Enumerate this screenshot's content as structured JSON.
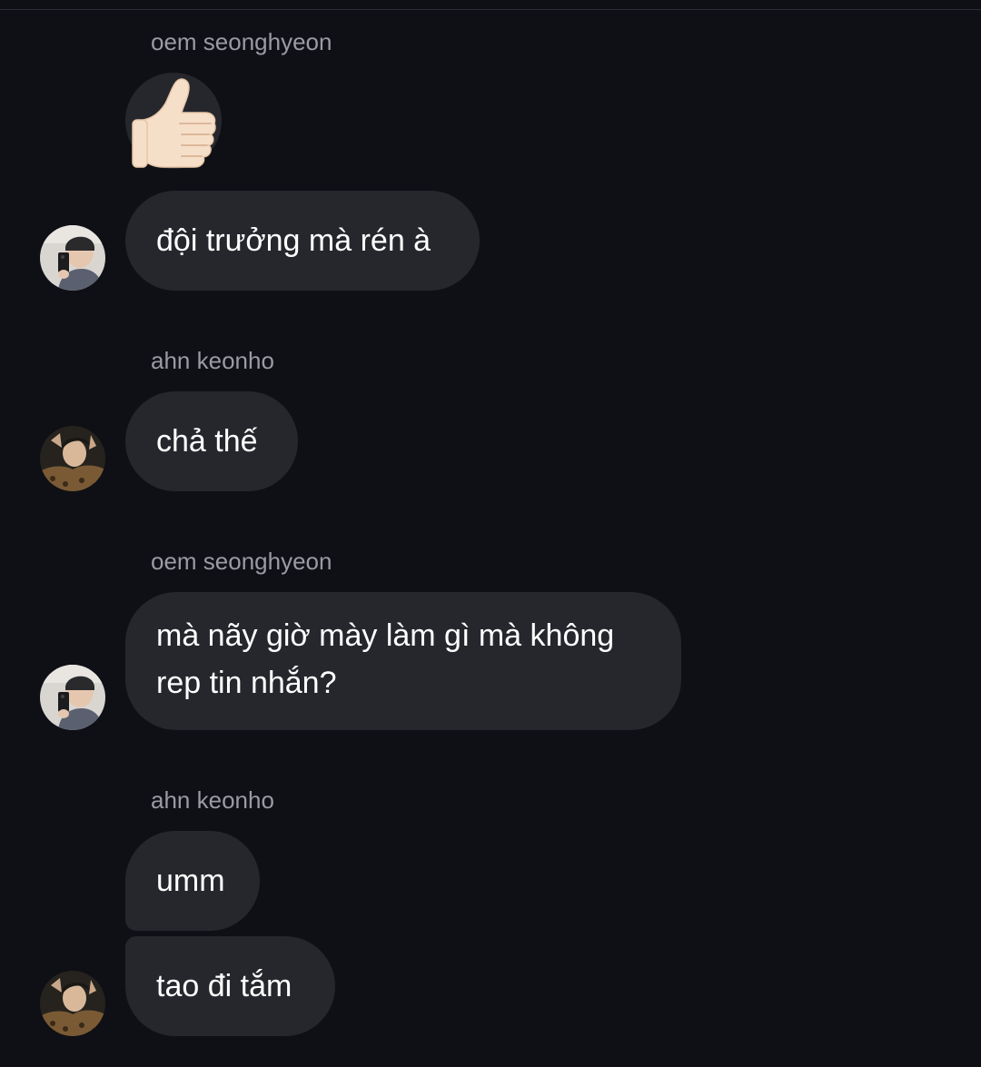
{
  "messages": [
    {
      "sender": "oem seonghyeon",
      "type": "emoji",
      "emoji": "thumbs-up"
    },
    {
      "sender": "oem seonghyeon",
      "type": "text",
      "text": "đội trưởng mà rén à"
    },
    {
      "sender": "ahn keonho",
      "type": "text",
      "text": "chả thế"
    },
    {
      "sender": "oem seonghyeon",
      "type": "text",
      "text": "mà nãy giờ mày làm gì mà không rep tin nhắn?"
    },
    {
      "sender": "ahn keonho",
      "type": "text",
      "text": "umm"
    },
    {
      "sender": "ahn keonho",
      "type": "text",
      "text": "tao đi tắm"
    }
  ],
  "groups": [
    {
      "sender_name": "oem seonghyeon"
    },
    {
      "sender_name": "ahn keonho"
    },
    {
      "sender_name": "oem seonghyeon"
    },
    {
      "sender_name": "ahn keonho"
    }
  ],
  "colors": {
    "background": "#0f1015",
    "bubble": "#25272d",
    "sender_text": "#9a9ba3",
    "message_text": "#ffffff"
  },
  "icons": {
    "reaction": "thumbs-up-icon",
    "avatar_oem": "avatar-oem-seonghyeon",
    "avatar_ahn": "avatar-ahn-keonho"
  }
}
